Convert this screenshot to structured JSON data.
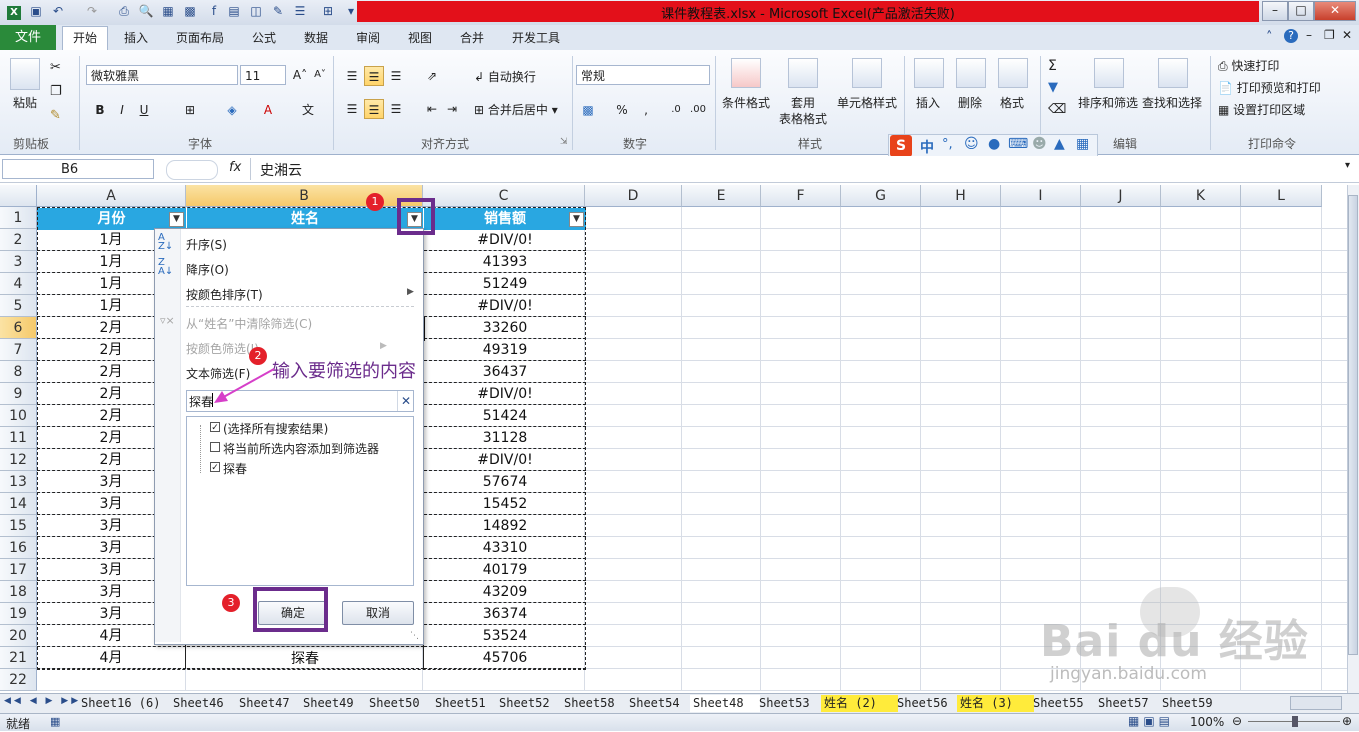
{
  "window": {
    "title": "课件教程表.xlsx - Microsoft Excel(产品激活失败)"
  },
  "tabs": [
    "文件",
    "开始",
    "插入",
    "页面布局",
    "公式",
    "数据",
    "审阅",
    "视图",
    "合并",
    "开发工具"
  ],
  "ribbon": {
    "clipboard": {
      "paste": "粘贴",
      "label": "剪贴板"
    },
    "font": {
      "name": "微软雅黑",
      "size": "11",
      "label": "字体"
    },
    "align": {
      "wrap": "自动换行",
      "merge": "合并后居中",
      "label": "对齐方式"
    },
    "number": {
      "format": "常规",
      "label": "数字"
    },
    "styles": {
      "cond": "条件格式",
      "table1": "套用",
      "table2": "表格格式",
      "cell": "单元格样式",
      "label": "样式"
    },
    "cells": {
      "insert": "插入",
      "delete": "删除",
      "format": "格式"
    },
    "edit": {
      "sort": "排序和筛选",
      "find": "查找和选择",
      "label": "编辑"
    },
    "print": {
      "quick": "快速打印",
      "preview": "打印预览和打印",
      "area": "设置打印区域",
      "label": "打印命令"
    },
    "ime": {
      "mode": "中"
    }
  },
  "formula": {
    "cell_ref": "B6",
    "fx": "fx",
    "value": "史湘云"
  },
  "columns": [
    "A",
    "B",
    "C",
    "D",
    "E",
    "F",
    "G",
    "H",
    "I",
    "J",
    "K",
    "L"
  ],
  "rows": [
    "1",
    "2",
    "3",
    "4",
    "5",
    "6",
    "7",
    "8",
    "9",
    "10",
    "11",
    "12",
    "13",
    "14",
    "15",
    "16",
    "17",
    "18",
    "19",
    "20",
    "21",
    "22"
  ],
  "table": {
    "headers": [
      "月份",
      "姓名",
      "销售额"
    ],
    "months": [
      "1月",
      "1月",
      "1月",
      "1月",
      "2月",
      "2月",
      "2月",
      "2月",
      "2月",
      "2月",
      "2月",
      "3月",
      "3月",
      "3月",
      "3月",
      "3月",
      "3月",
      "3月",
      "4月",
      "4月"
    ],
    "sales": [
      "#DIV/0!",
      "41393",
      "51249",
      "#DIV/0!",
      "33260",
      "49319",
      "36437",
      "#DIV/0!",
      "51424",
      "31128",
      "#DIV/0!",
      "57674",
      "15452",
      "14892",
      "43310",
      "40179",
      "43209",
      "36374",
      "53524",
      "45706"
    ],
    "name_row21": "探春"
  },
  "dropdown": {
    "sort_asc": "升序(S)",
    "sort_desc": "降序(O)",
    "sort_color": "按颜色排序(T)",
    "clear": "从“姓名”中清除筛选(C)",
    "filter_color": "按颜色筛选(I)",
    "text_filter": "文本筛选(F)",
    "search_value": "探春",
    "options": [
      {
        "label": "(选择所有搜索结果)",
        "checked": true
      },
      {
        "label": "将当前所选内容添加到筛选器",
        "checked": false
      },
      {
        "label": "探春",
        "checked": true
      }
    ],
    "ok": "确定",
    "cancel": "取消"
  },
  "annotations": {
    "b1": "1",
    "b2": "2",
    "b3": "3",
    "hint": "输入要筛选的内容"
  },
  "sheets": [
    "Sheet16 (6)",
    "Sheet46",
    "Sheet47",
    "Sheet49",
    "Sheet50",
    "Sheet51",
    "Sheet52",
    "Sheet58",
    "Sheet54",
    "Sheet48",
    "Sheet53",
    "姓名 (2)",
    "Sheet56",
    "姓名 (3)",
    "Sheet55",
    "Sheet57",
    "Sheet59"
  ],
  "status": {
    "ready": "就绪",
    "zoom": "100%"
  },
  "watermark": {
    "brand": "Bai du 经验",
    "url": "jingyan.baidu.com"
  },
  "colors": {
    "header_blue": "#29a7e1",
    "annotation_purple": "#6b2c8c",
    "badge_red": "#e4202a"
  }
}
